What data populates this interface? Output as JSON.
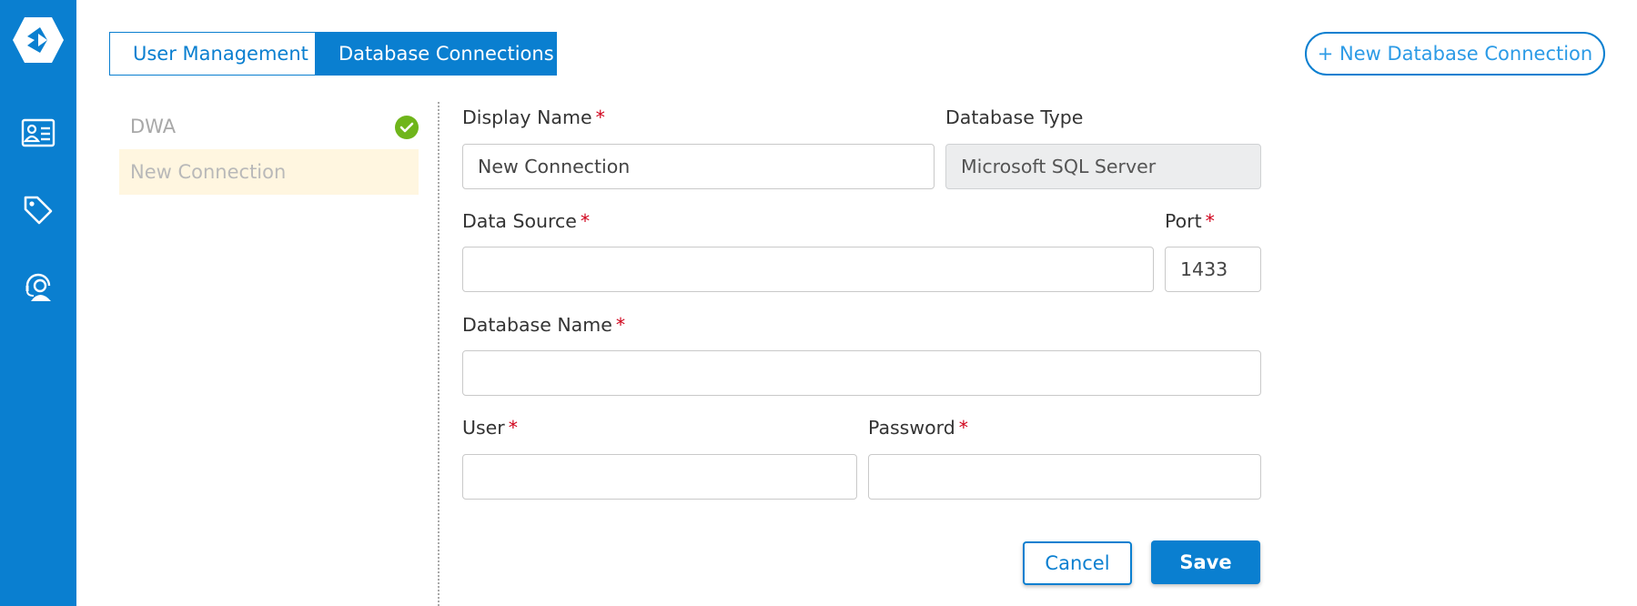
{
  "tabs": [
    {
      "label": "User Management",
      "active": false
    },
    {
      "label": "Database Connections",
      "active": true
    }
  ],
  "new_connection_button": "+ New Database Connection",
  "connections": [
    {
      "name": "DWA",
      "status": "connected"
    },
    {
      "name": "New Connection",
      "status": "selected"
    }
  ],
  "form": {
    "display_name": {
      "label": "Display Name",
      "required": "*",
      "value": "New Connection"
    },
    "database_type": {
      "label": "Database Type",
      "value": "Microsoft SQL Server"
    },
    "data_source": {
      "label": "Data Source",
      "required": "*",
      "value": ""
    },
    "port": {
      "label": "Port",
      "required": "*",
      "value": "1433"
    },
    "database_name": {
      "label": "Database Name",
      "required": "*",
      "value": ""
    },
    "user": {
      "label": "User",
      "required": "*",
      "value": ""
    },
    "password": {
      "label": "Password",
      "required": "*",
      "value": ""
    }
  },
  "actions": {
    "cancel": "Cancel",
    "save": "Save"
  },
  "colors": {
    "primary": "#0a7fd0",
    "success": "#6fb51b",
    "required": "#d0021b",
    "selected_bg": "#fff6e0"
  },
  "icons": [
    "logo-icon",
    "contact-card-icon",
    "tag-icon",
    "support-agent-icon",
    "check-icon"
  ]
}
